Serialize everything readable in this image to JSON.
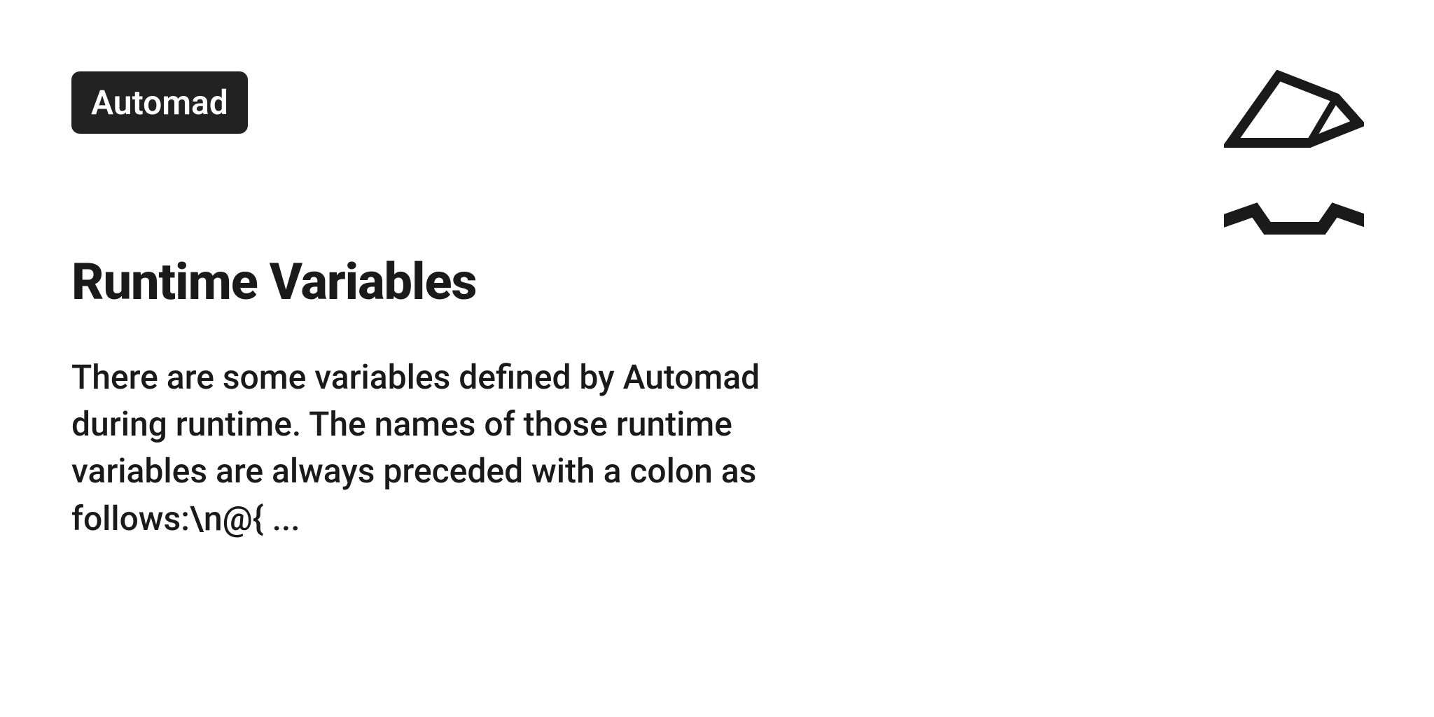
{
  "badge": {
    "label": "Automad"
  },
  "content": {
    "heading": "Runtime Variables",
    "body": "There are some variables defined by Automad during runtime. The names of those runtime variables are always preceded with a colon as follows:\\n@{ ..."
  }
}
